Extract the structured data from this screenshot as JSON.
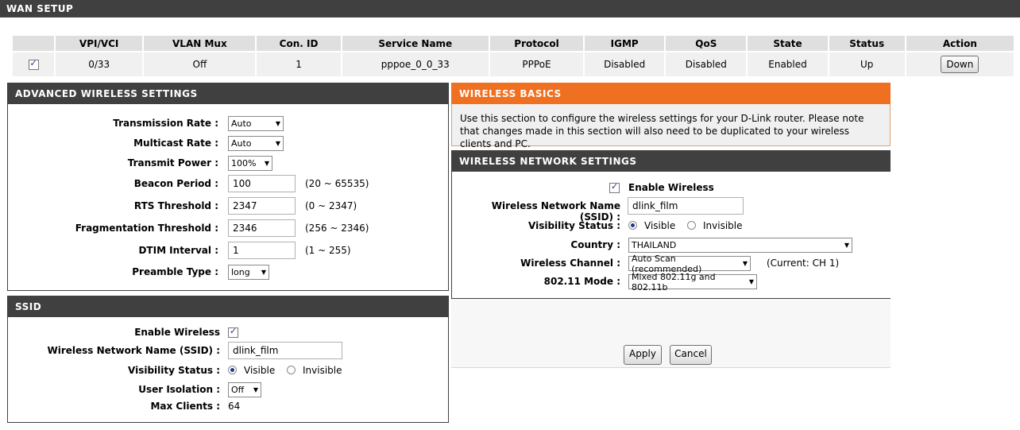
{
  "wan": {
    "title": "WAN SETUP",
    "columns": [
      "",
      "VPI/VCI",
      "VLAN Mux",
      "Con. ID",
      "Service Name",
      "Protocol",
      "IGMP",
      "QoS",
      "State",
      "Status",
      "Action"
    ],
    "row": {
      "checked": true,
      "vpi_vci": "0/33",
      "vlan_mux": "Off",
      "con_id": "1",
      "service_name": "pppoe_0_0_33",
      "protocol": "PPPoE",
      "igmp": "Disabled",
      "qos": "Disabled",
      "state": "Enabled",
      "status": "Up",
      "action_label": "Down"
    }
  },
  "advanced": {
    "title": "ADVANCED WIRELESS SETTINGS",
    "transmission_rate": {
      "label": "Transmission Rate :",
      "value": "Auto"
    },
    "multicast_rate": {
      "label": "Multicast Rate :",
      "value": "Auto"
    },
    "transmit_power": {
      "label": "Transmit Power :",
      "value": "100%"
    },
    "beacon_period": {
      "label": "Beacon Period :",
      "value": "100",
      "range": "(20 ~ 65535)"
    },
    "rts_threshold": {
      "label": "RTS Threshold :",
      "value": "2347",
      "range": "(0 ~ 2347)"
    },
    "fragmentation_threshold": {
      "label": "Fragmentation Threshold :",
      "value": "2346",
      "range": "(256 ~ 2346)"
    },
    "dtim_interval": {
      "label": "DTIM Interval :",
      "value": "1",
      "range": "(1 ~ 255)"
    },
    "preamble_type": {
      "label": "Preamble Type :",
      "value": "long"
    }
  },
  "ssid": {
    "title": "SSID",
    "enable_wireless_label": "Enable Wireless",
    "enable_wireless_checked": true,
    "ssid_label": "Wireless Network Name (SSID) :",
    "ssid_value": "dlink_film",
    "visibility_label": "Visibility Status :",
    "visible_label": "Visible",
    "invisible_label": "Invisible",
    "visibility": "Visible",
    "isolation_label": "User Isolation :",
    "isolation_value": "Off",
    "max_clients_label": "Max Clients :",
    "max_clients_value": "64"
  },
  "basics": {
    "title": "WIRELESS BASICS",
    "description": "Use this section to configure the wireless settings for your D-Link router. Please note that changes made in this section will also need to be duplicated to your wireless clients and PC."
  },
  "network": {
    "title": "WIRELESS NETWORK SETTINGS",
    "enable_wireless_label": "Enable Wireless",
    "enable_wireless_checked": true,
    "ssid_label": "Wireless Network Name (SSID) :",
    "ssid_value": "dlink_film",
    "visibility_label": "Visibility Status :",
    "visible_label": "Visible",
    "invisible_label": "Invisible",
    "visibility": "Visible",
    "country_label": "Country :",
    "country_value": "THAILAND",
    "channel_label": "Wireless Channel :",
    "channel_value": "Auto Scan (recommended)",
    "channel_current": "(Current: CH 1)",
    "mode_label": "802.11 Mode :",
    "mode_value": "Mixed 802.11g and 802.11b"
  },
  "buttons": {
    "apply": "Apply",
    "cancel": "Cancel"
  },
  "colors": {
    "header_dark": "#404040",
    "header_orange": "#f07022",
    "cell_bg": "#f0f0f0",
    "th_bg": "#dfdfdf"
  }
}
